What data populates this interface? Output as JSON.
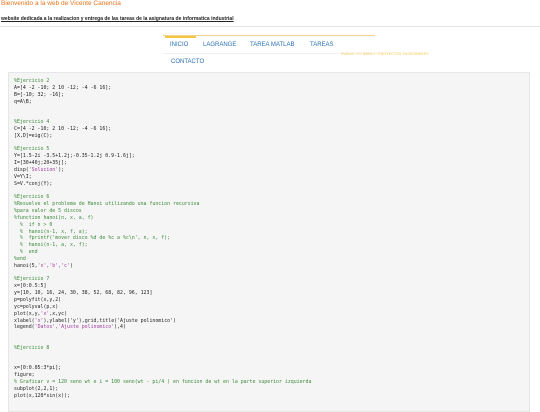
{
  "header": {
    "title": "Bienvenido a la web de Vicente Canencia",
    "tagline": "website dedicada a la realizacion y entrega de las tareas de la asignatura de informatica industrial"
  },
  "nav": {
    "items": [
      "INICIO",
      "LAGRANGE",
      "TAREA MATLAB",
      "TAREAS"
    ],
    "active": "INICIO",
    "row2": "CONTACTO"
  },
  "blog_note": "PUBLIC ??? BERL?? PROYECTOS FASSOBRIERY",
  "colors": {
    "title": "#e8731a",
    "nav_link": "#2a6fb5",
    "nav_accent": "#f4c542",
    "comment": "#3a8a3a",
    "string": "#a03aa0",
    "code_bg": "#f5f5f5"
  },
  "code_lines": [
    {
      "t": "%Ejercicio 2",
      "k": "c"
    },
    {
      "t": "A=[4 -2 -10; 2 10 -12; -4 -6 16];",
      "k": ""
    },
    {
      "t": "B=[-10; 32; -16];",
      "k": ""
    },
    {
      "t": "q=A\\B;",
      "k": ""
    },
    {
      "t": "",
      "k": ""
    },
    {
      "t": "",
      "k": ""
    },
    {
      "t": "%Ejercicio 4",
      "k": "c"
    },
    {
      "t": "C=[4 -2 -10; 2 10 -12; -4 -6 16];",
      "k": ""
    },
    {
      "t": "[X,D]=eig(C);",
      "k": ""
    },
    {
      "t": "",
      "k": ""
    },
    {
      "t": "%Ejercicio 5",
      "k": "c"
    },
    {
      "t": "Y=[1.5-2i -3.5+1.2j;-0.35-1.2j 0.9-1.6j];",
      "k": ""
    },
    {
      "t": "I=[30+40j;20+35j];",
      "k": ""
    },
    {
      "t": "disp('Solucion');",
      "k": "mixed",
      "pre": "disp(",
      "str": "'Solucion'",
      "post": ");"
    },
    {
      "t": "V=Y\\I;",
      "k": ""
    },
    {
      "t": "S=V.*conj(Y);",
      "k": ""
    },
    {
      "t": "",
      "k": ""
    },
    {
      "t": "%Ejercicio 6",
      "k": "c"
    },
    {
      "t": "%Resuelve el problema de Hanoi utilizando una funcion recursiva",
      "k": "c"
    },
    {
      "t": "%para valor de 5 discos",
      "k": "c"
    },
    {
      "t": "%function hanoi(n, x, a, f)",
      "k": "c"
    },
    {
      "t": "  %  if n > 0",
      "k": "c"
    },
    {
      "t": "  %  hanoi(n-1, x, f, a);",
      "k": "c"
    },
    {
      "t": "  %  fprintf('mover disco %d de %c a %c\\n', n, x, f);",
      "k": "c"
    },
    {
      "t": "  %  hanoi(n-1, a, x, f);",
      "k": "c"
    },
    {
      "t": "  %  end",
      "k": "c"
    },
    {
      "t": "%end",
      "k": "c"
    },
    {
      "t": "hanoi(5,'x','b','c')",
      "k": "mixed",
      "pre": "hanoi(5,",
      "str": "'x','b','c'",
      "post": ")"
    },
    {
      "t": "",
      "k": ""
    },
    {
      "t": "%Ejercicio 7",
      "k": "c"
    },
    {
      "t": "x=[0:0.5:5]",
      "k": ""
    },
    {
      "t": "y=[10, 10, 16, 24, 30, 38, 52, 68, 82, 96, 123]",
      "k": ""
    },
    {
      "t": "p=polyfit(x,y,2)",
      "k": ""
    },
    {
      "t": "yc=polyval(p,x)",
      "k": ""
    },
    {
      "t": "plot(x,y,'x',x,yc)",
      "k": "mixed",
      "pre": "plot(x,y,",
      "str": "'x'",
      "post": ",x,yc)"
    },
    {
      "t": "xlabel('x'),ylabel('y'),grid,title('Ajuste polinomico')",
      "k": "mixed",
      "pre": "xlabel(",
      "str": "'x'",
      "post": "),ylabel('y'),grid,title('Ajuste polinomico')"
    },
    {
      "t": "legend('Datos','Ajuste polinomico'),4)",
      "k": "mixed",
      "pre": "legend(",
      "str": "'Datos','Ajuste polinomico'",
      "post": "),4)"
    },
    {
      "t": "",
      "k": ""
    },
    {
      "t": "",
      "k": ""
    },
    {
      "t": "%Ejercicio 8",
      "k": "c"
    },
    {
      "t": "",
      "k": ""
    },
    {
      "t": "",
      "k": ""
    },
    {
      "t": "x=[0:0.05:3*pi];",
      "k": ""
    },
    {
      "t": "figure;",
      "k": ""
    },
    {
      "t": "% Graficar v = 120 seno wt e i = 100 seno(wt - pi/4 ) en funcion de wt en la parte superior izquierda",
      "k": "c"
    },
    {
      "t": "subplot(2,2,1);",
      "k": ""
    },
    {
      "t": "plot(x,120*sin(x));",
      "k": ""
    }
  ]
}
